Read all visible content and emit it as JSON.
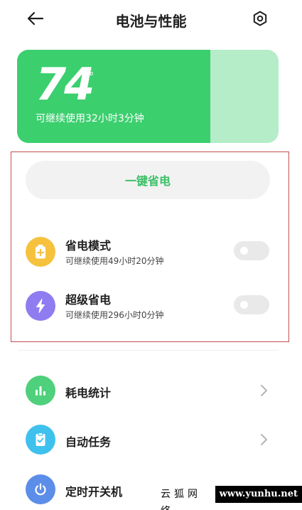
{
  "header": {
    "title": "电池与性能"
  },
  "battery": {
    "percent": "74",
    "percent_level": 0.74,
    "unit": "%",
    "remaining": "可继续使用32小时3分钟"
  },
  "one_key": {
    "label": "一键省电"
  },
  "modes": [
    {
      "title": "省电模式",
      "subtitle": "可继续使用49小时20分钟",
      "icon": "battery-plus-icon",
      "color": "#f6c23e",
      "enabled": false
    },
    {
      "title": "超级省电",
      "subtitle": "可继续使用296小时0分钟",
      "icon": "lightning-icon",
      "color": "#8f7cf0",
      "enabled": false
    }
  ],
  "menu": [
    {
      "label": "耗电统计",
      "icon": "bar-chart-icon",
      "color": "#4fd07c"
    },
    {
      "label": "自动任务",
      "icon": "clipboard-check-icon",
      "color": "#3fc1ee"
    },
    {
      "label": "定时开关机",
      "icon": "power-icon",
      "color": "#5c8de8"
    }
  ],
  "watermark": {
    "cn": "云狐网络",
    "url": "www.yunhu.net"
  },
  "colors": {
    "accent_green": "#3ccf6e",
    "card_light": "#b4edc8",
    "highlight_border": "#c0504d"
  }
}
